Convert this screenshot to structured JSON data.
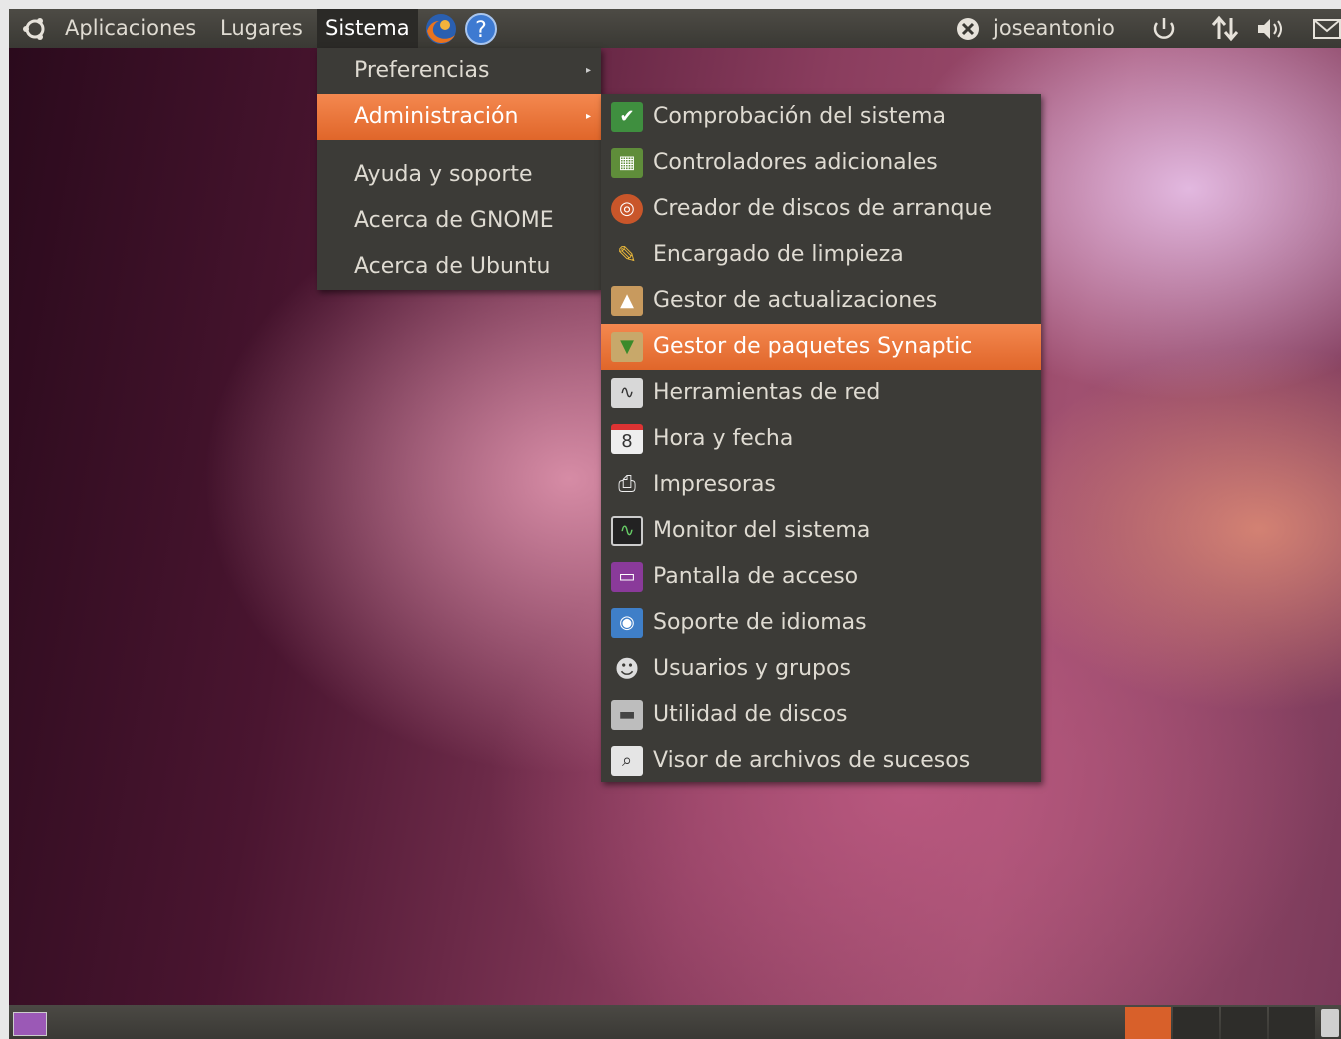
{
  "top_panel": {
    "applications": "Aplicaciones",
    "places": "Lugares",
    "system": "Sistema",
    "username": "joseantonio",
    "icons": [
      "ubuntu-logo-icon",
      "firefox-icon",
      "help-icon",
      "user-status-icon",
      "power-icon",
      "network-icon",
      "volume-icon",
      "mail-icon"
    ]
  },
  "system_menu": {
    "items": [
      {
        "label": "Preferencias",
        "submenu": true
      },
      {
        "label": "Administración",
        "submenu": true,
        "active": true
      },
      {
        "label": "Ayuda y soporte"
      },
      {
        "label": "Acerca de GNOME"
      },
      {
        "label": "Acerca de Ubuntu"
      }
    ]
  },
  "admin_menu": {
    "items": [
      {
        "label": "Comprobación del sistema",
        "icon": "checkmark-monitor-icon"
      },
      {
        "label": "Controladores adicionales",
        "icon": "driver-card-icon"
      },
      {
        "label": "Creador de discos de arranque",
        "icon": "usb-disk-icon"
      },
      {
        "label": "Encargado de limpieza",
        "icon": "broom-icon"
      },
      {
        "label": "Gestor de actualizaciones",
        "icon": "update-box-icon"
      },
      {
        "label": "Gestor de paquetes Synaptic",
        "icon": "package-download-icon",
        "active": true
      },
      {
        "label": "Herramientas de red",
        "icon": "network-tools-icon"
      },
      {
        "label": "Hora y fecha",
        "icon": "calendar-clock-icon"
      },
      {
        "label": "Impresoras",
        "icon": "printer-icon"
      },
      {
        "label": "Monitor del sistema",
        "icon": "system-monitor-icon"
      },
      {
        "label": "Pantalla de acceso",
        "icon": "login-screen-icon"
      },
      {
        "label": "Soporte de idiomas",
        "icon": "globe-icon"
      },
      {
        "label": "Usuarios y grupos",
        "icon": "users-icon"
      },
      {
        "label": "Utilidad de discos",
        "icon": "disk-icon"
      },
      {
        "label": "Visor de archivos de sucesos",
        "icon": "log-viewer-icon"
      }
    ]
  },
  "colors": {
    "panel": "#3c3b37",
    "highlight": "#e9703a",
    "menu_bg": "#3c3b37",
    "text": "#dfdbd2"
  }
}
